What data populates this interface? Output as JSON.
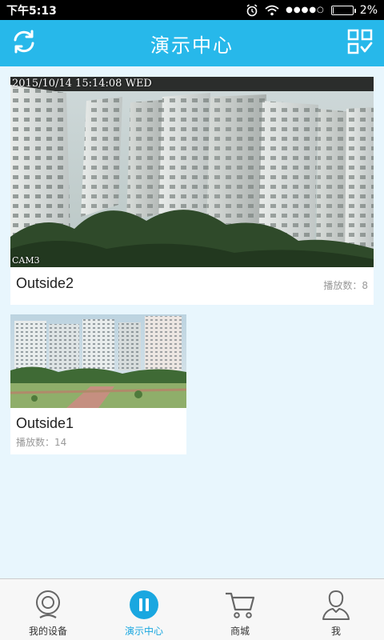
{
  "status_bar": {
    "time": "下午5:13",
    "signal_dots": "●●●●○",
    "battery_percent": "2%",
    "battery_level": 0.02,
    "icons": [
      "alarm-icon",
      "wifi-icon",
      "signal-icon",
      "battery-icon"
    ]
  },
  "header": {
    "title": "演示中心",
    "left_icon": "refresh-icon",
    "right_icon": "scan-icon",
    "background": "#27b8ea"
  },
  "cameras": [
    {
      "name": "Outside2",
      "plays_label": "播放数：8",
      "osd_datetime": "2015/10/14 15:14:08 WED",
      "osd_cam": "CAM3"
    },
    {
      "name": "Outside1",
      "plays_label": "播放数：14"
    }
  ],
  "bottom_nav": {
    "items": [
      {
        "label": "我的设备",
        "icon": "camera-icon"
      },
      {
        "label": "演示中心",
        "icon": "pause-icon",
        "active": true
      },
      {
        "label": "商城",
        "icon": "cart-icon"
      },
      {
        "label": "我",
        "icon": "user-icon"
      }
    ],
    "active_color": "#1aa7e0"
  }
}
